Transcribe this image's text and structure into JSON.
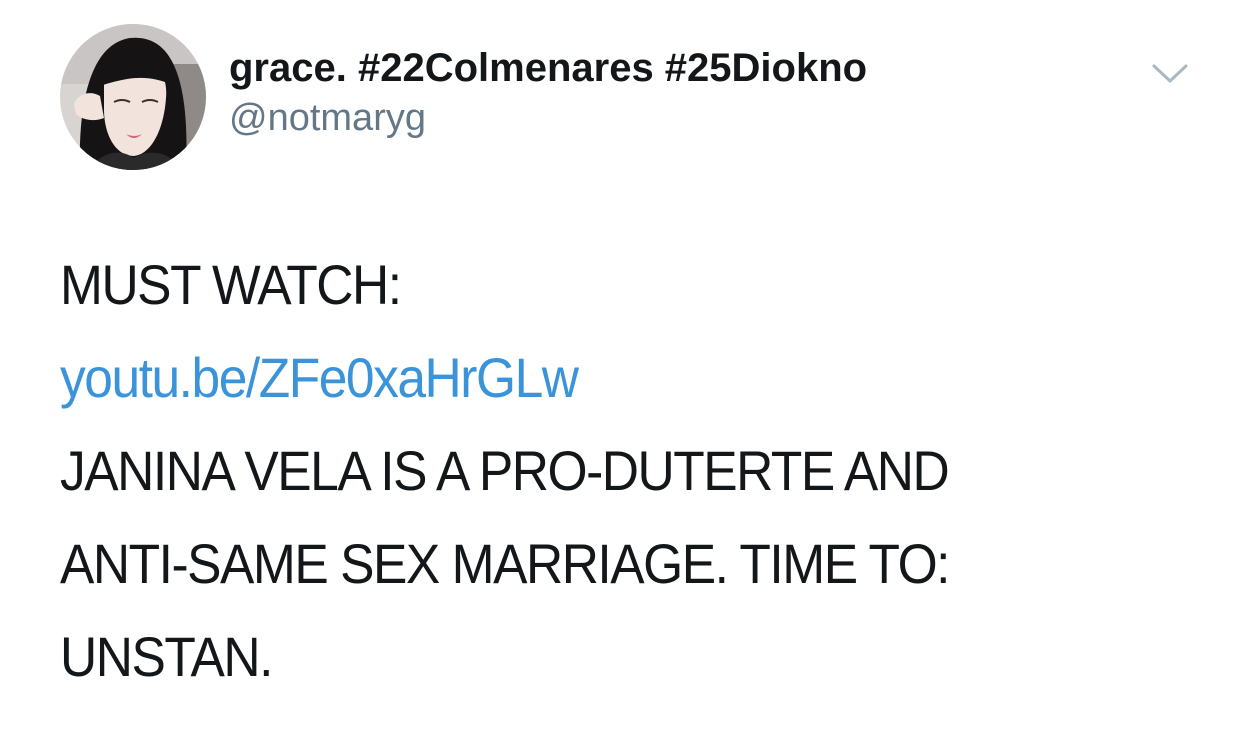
{
  "tweet": {
    "author": {
      "display_name": "grace. #22Colmenares #25Diokno",
      "handle": "@notmaryg",
      "avatar_icon": "profile-photo"
    },
    "menu_icon": "chevron-down-icon",
    "body": {
      "heading": "MUST WATCH:",
      "link": "youtu.be/ZFe0xaHrGLw",
      "lines": [
        "JANINA VELA IS A PRO-DUTERTE AND",
        "ANTI-SAME SEX MARRIAGE. TIME TO:",
        "UNSTAN."
      ]
    },
    "colors": {
      "text": "#14171a",
      "secondary": "#657786",
      "link": "#3b94d9",
      "chevron": "#aab8c2"
    }
  }
}
